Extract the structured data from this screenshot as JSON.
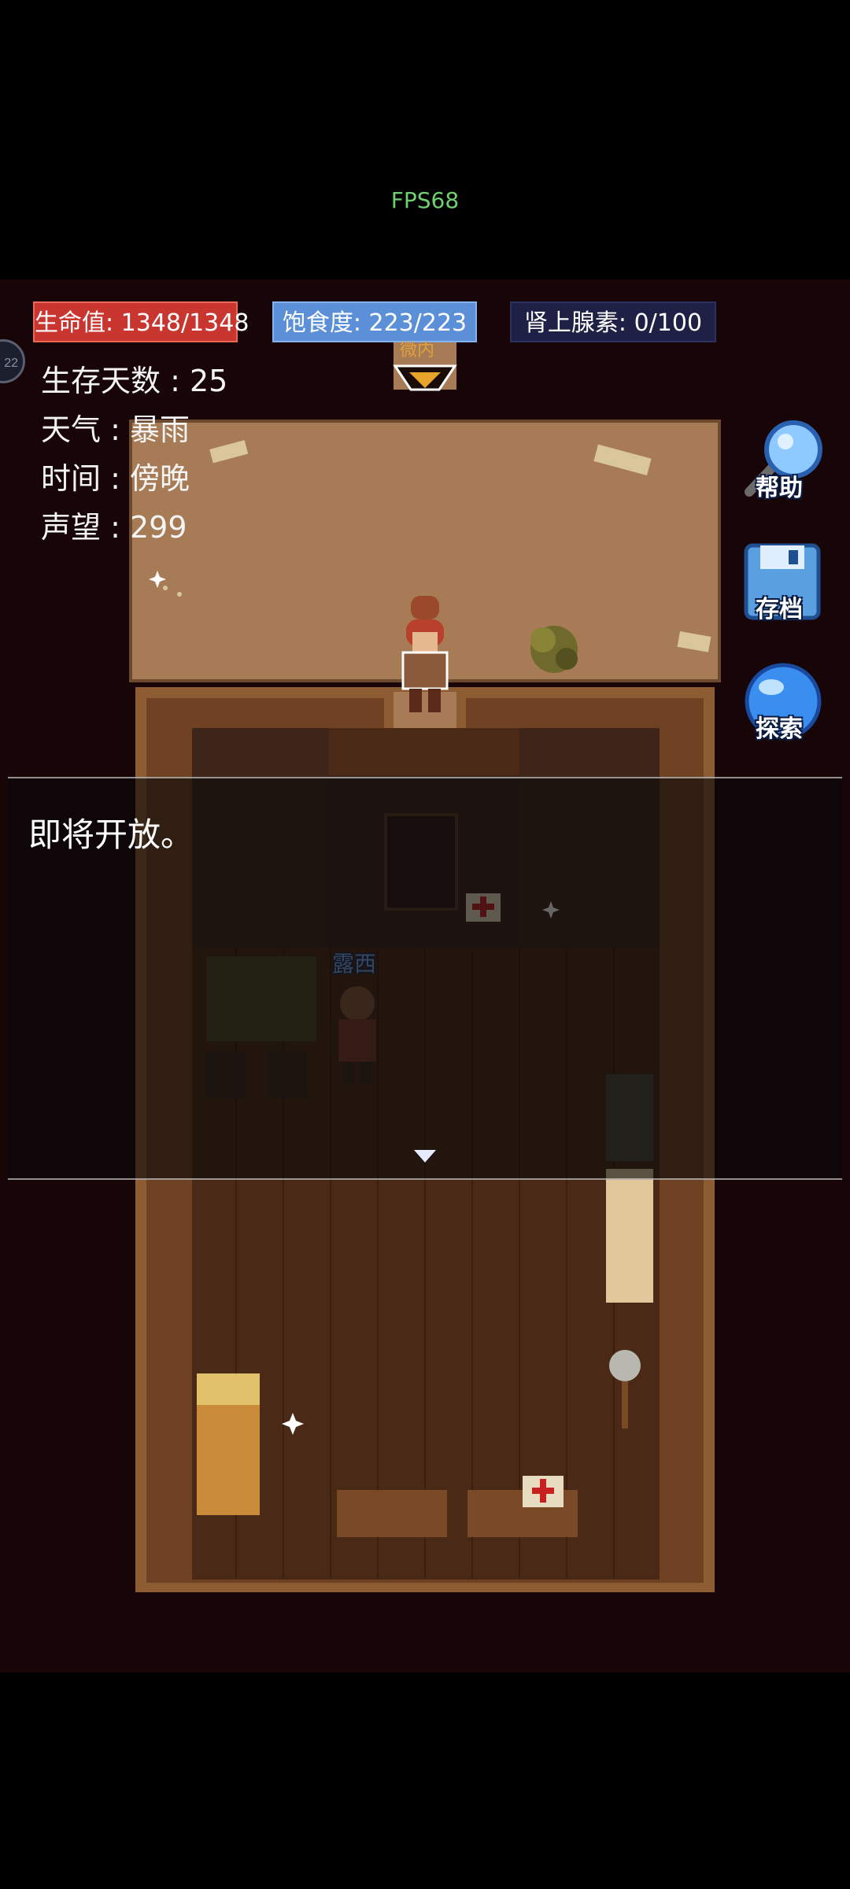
{
  "fps": "FPS68",
  "bars": {
    "hp": "生命值: 1348/1348",
    "food": "饱食度: 223/223",
    "adrenaline": "肾上腺素: 0/100"
  },
  "avatar_label": "22",
  "stats": {
    "days": "生存天数 : 25",
    "weather": "天气 : 暴雨",
    "time": "时间 : 傍晚",
    "reputation": "声望 : 299"
  },
  "door_label": "微内",
  "npc_name": "露西",
  "buttons": {
    "help": "帮助",
    "save": "存档",
    "explore": "探索"
  },
  "dialog": {
    "text": "即将开放。"
  },
  "colors": {
    "hp": "#c8362f",
    "food": "#5b8fd8",
    "adrenaline": "#1e2145",
    "yard": "#a77b55",
    "floor": "#4a2a16"
  }
}
